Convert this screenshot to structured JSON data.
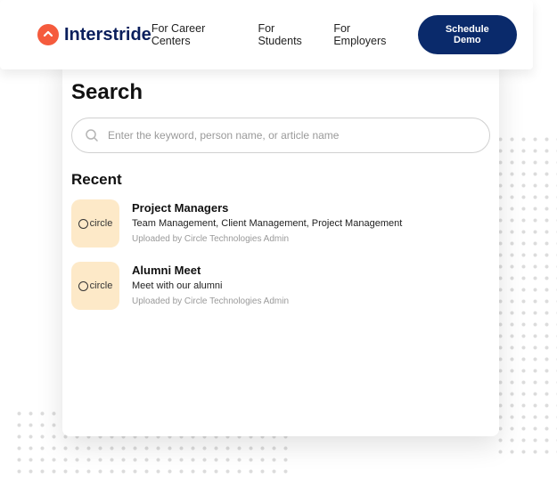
{
  "brand": {
    "name": "Interstride"
  },
  "nav": {
    "links": [
      "For Career Centers",
      "For Students",
      "For Employers"
    ],
    "cta": "Schedule Demo"
  },
  "search": {
    "heading": "Search",
    "placeholder": "Enter the keyword, person name, or article name"
  },
  "recent": {
    "heading": "Recent",
    "items": [
      {
        "thumb_label": "circle",
        "title": "Project Managers",
        "subtitle": "Team Management, Client Management, Project Management",
        "meta": "Uploaded by Circle Technologies Admin"
      },
      {
        "thumb_label": "circle",
        "title": "Alumni Meet",
        "subtitle": "Meet with our alumni",
        "meta": "Uploaded by Circle Technologies Admin"
      }
    ]
  }
}
